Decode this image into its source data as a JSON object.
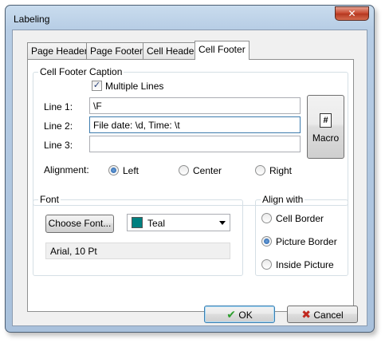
{
  "window": {
    "title": "Labeling",
    "close_glyph": "✕"
  },
  "tabs": [
    {
      "label": "Page Header",
      "active": false
    },
    {
      "label": "Page Footer",
      "active": false
    },
    {
      "label": "Cell Header",
      "active": false
    },
    {
      "label": "Cell Footer",
      "active": true
    }
  ],
  "caption": {
    "group_title": "Cell Footer Caption",
    "multiple_lines": {
      "label": "Multiple Lines",
      "checked": true
    },
    "line1": {
      "label": "Line 1:",
      "value": "\\F"
    },
    "line2": {
      "label": "Line 2:",
      "value": "File date: \\d, Time: \\t"
    },
    "line3": {
      "label": "Line 3:",
      "value": ""
    },
    "macro_button": {
      "label": "Macro",
      "icon": "hash-icon",
      "glyph": "#"
    },
    "alignment": {
      "label": "Alignment:",
      "options": [
        {
          "label": "Left",
          "checked": true
        },
        {
          "label": "Center",
          "checked": false
        },
        {
          "label": "Right",
          "checked": false
        }
      ]
    }
  },
  "font": {
    "group_title": "Font",
    "choose_button": "Choose Font...",
    "color": {
      "name": "Teal",
      "hex": "#008080"
    },
    "current_font": "Arial, 10 Pt"
  },
  "align_with": {
    "group_title": "Align with",
    "options": [
      {
        "label": "Cell Border",
        "checked": false
      },
      {
        "label": "Picture Border",
        "checked": true
      },
      {
        "label": "Inside Picture",
        "checked": false
      }
    ]
  },
  "footer": {
    "ok": {
      "label": "OK",
      "icon": "checkmark-icon",
      "glyph": "✔",
      "color": "#2e9e2e"
    },
    "cancel": {
      "label": "Cancel",
      "icon": "x-mark-icon",
      "glyph": "✖",
      "color": "#c0281f"
    }
  }
}
